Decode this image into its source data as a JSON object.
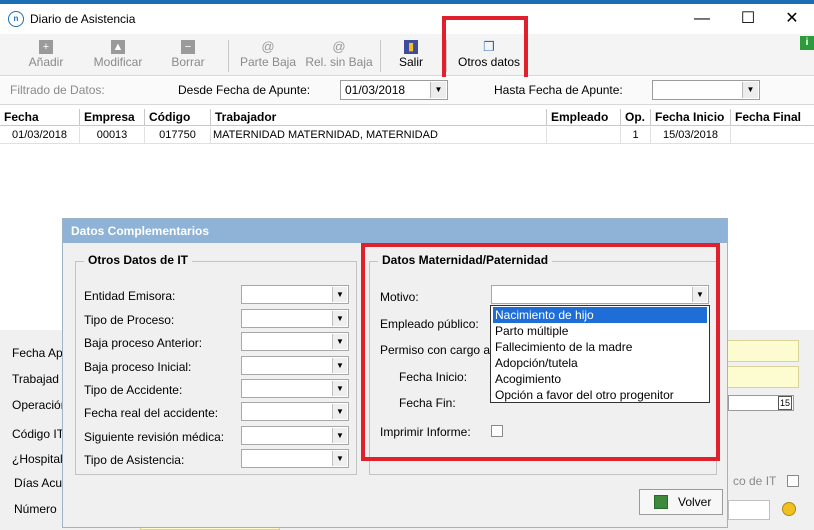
{
  "window": {
    "title": "Diario de Asistencia",
    "icon": "app-logo-icon",
    "minimize": "—",
    "maximize": "☐",
    "close": "✕"
  },
  "toolbar": {
    "buttons": [
      {
        "label": "Añadir",
        "icon": "add-icon",
        "glyph": "+"
      },
      {
        "label": "Modificar",
        "icon": "modify-icon",
        "glyph": "▲"
      },
      {
        "label": "Borrar",
        "icon": "delete-icon",
        "glyph": "−"
      },
      {
        "label": "Parte Baja",
        "icon": "at-icon",
        "glyph": "@"
      },
      {
        "label": "Rel. sin Baja",
        "icon": "at-icon",
        "glyph": "@"
      },
      {
        "label": "Salir",
        "icon": "exit-door-icon",
        "glyph": "▮"
      },
      {
        "label": "Otros datos",
        "icon": "windows-icon",
        "glyph": "❐"
      }
    ],
    "info_badge": "i"
  },
  "filter": {
    "label": "Filtrado de Datos:",
    "from_label": "Desde Fecha de Apunte:",
    "from_value": "01/03/2018",
    "to_label": "Hasta Fecha de Apunte:",
    "to_value": ""
  },
  "grid": {
    "columns": [
      "Fecha",
      "Empresa",
      "Código",
      "Trabajador",
      "Empleado",
      "Op.",
      "Fecha Inicio",
      "Fecha Final"
    ],
    "rows": [
      [
        "01/03/2018",
        "00013",
        "017750",
        "MATERNIDAD MATERNIDAD, MATERNIDAD",
        "",
        "1",
        "15/03/2018",
        ""
      ]
    ]
  },
  "background_form": {
    "labels": [
      "Fecha Ap",
      "Trabajad",
      "Operación",
      "Código IT",
      "¿Hospitali",
      "Días Acun",
      "Número"
    ],
    "right_label": "co de IT",
    "small_field_value": "15"
  },
  "modal": {
    "title": "Datos Complementarios",
    "it_group": {
      "title": "Otros Datos de IT",
      "fields": [
        "Entidad Emisora:",
        "Tipo de Proceso:",
        "Baja proceso Anterior:",
        "Baja proceso Inicial:",
        "Tipo de Accidente:",
        "Fecha real del accidente:",
        "Siguiente revisión médica:",
        "Tipo de Asistencia:"
      ]
    },
    "mat_group": {
      "title": "Datos Maternidad/Paternidad",
      "motivo_label": "Motivo:",
      "empleado_label": "Empleado público:",
      "permiso_label": "Permiso con cargo a",
      "fecha_inicio_label": "Fecha Inicio:",
      "fecha_fin_label": "Fecha Fin:",
      "imprimir_label": "Imprimir Informe:"
    },
    "motivo_options": [
      "Nacimiento de hijo",
      "Parto múltiple",
      "Fallecimiento de la madre",
      "Adopción/tutela",
      "Acogimiento",
      "Opción a favor del otro progenitor"
    ],
    "volver_label": "Volver"
  },
  "colors": {
    "accent": "#1c6fb5",
    "highlight": "#e0202c",
    "selection": "#1f6ed8",
    "modal_title": "#8eb3d6"
  }
}
